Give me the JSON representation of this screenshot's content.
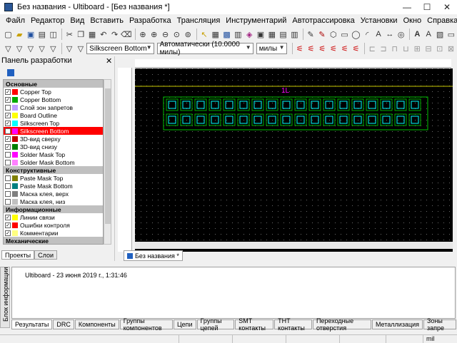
{
  "window": {
    "title": "Без названия - Ultiboard - [Без названия *]",
    "min": "—",
    "max": "☐",
    "close": "✕"
  },
  "menu": [
    "Файл",
    "Редактор",
    "Вид",
    "Вставить",
    "Разработка",
    "Трансляция",
    "Инструментарий",
    "Автотрассировка",
    "Установки",
    "Окно",
    "Справка"
  ],
  "toolbar": {
    "layer_select": "Silkscreen Bottom",
    "grid_select": "Автоматически (10.0000 милы)",
    "units_select": "милы"
  },
  "left_panel": {
    "title": "Панель разработки",
    "close": "✕",
    "groups": [
      {
        "name": "Основные",
        "items": [
          {
            "label": "Copper Top",
            "checked": true,
            "color": "#ff0000"
          },
          {
            "label": "Copper Bottom",
            "checked": true,
            "color": "#00aa00"
          },
          {
            "label": "Слой зон запретов",
            "checked": false,
            "color": "#c0a0ff"
          },
          {
            "label": "Board Outline",
            "checked": true,
            "color": "#ffff00"
          },
          {
            "label": "Silkscreen Top",
            "checked": true,
            "color": "#00ffff"
          },
          {
            "label": "Silkscreen Bottom",
            "checked": true,
            "color": "#ff00ff",
            "selected": true
          },
          {
            "label": "3D-вид сверху",
            "checked": true,
            "color": "#c00000"
          },
          {
            "label": "3D-вид снизу",
            "checked": true,
            "color": "#008000"
          },
          {
            "label": "Solder Mask Top",
            "checked": false,
            "color": "#ff00ff"
          },
          {
            "label": "Solder Mask Bottom",
            "checked": false,
            "color": "#ff80ff"
          }
        ]
      },
      {
        "name": "Конструктивные",
        "items": [
          {
            "label": "Paste Mask Top",
            "checked": false,
            "color": "#808000"
          },
          {
            "label": "Paste Mask Bottom",
            "checked": false,
            "color": "#008080"
          },
          {
            "label": "Маска клея, верх",
            "checked": false,
            "color": "#808080"
          },
          {
            "label": "Маска клея, низ",
            "checked": false,
            "color": "#c0c0c0"
          }
        ]
      },
      {
        "name": "Информационные",
        "items": [
          {
            "label": "Линии связи",
            "checked": true,
            "color": "#ffff00"
          },
          {
            "label": "Ошибки контроля",
            "checked": true,
            "color": "#ff0000"
          },
          {
            "label": "Комментарии",
            "checked": true,
            "color": "#ffff80"
          }
        ]
      },
      {
        "name": "Механические",
        "items": []
      }
    ],
    "tabs": [
      "Проекты",
      "Слои"
    ]
  },
  "design": {
    "doc_tab": "Без названия *",
    "component_label": "1L",
    "pad_rows": 2,
    "pad_cols": 18
  },
  "output": {
    "side_label": "Блок информации",
    "line": "Ultiboard  -  23 июня 2019 г., 1:31:46",
    "tabs": [
      "Результаты",
      "DRC",
      "Компоненты",
      "Группы компонентов",
      "Цепи",
      "Группы цепей",
      "SMT контакты",
      "THT контакты",
      "Переходные отверстия",
      "Металлизация",
      "Зоны запре"
    ]
  },
  "status": {
    "units": "mil"
  }
}
